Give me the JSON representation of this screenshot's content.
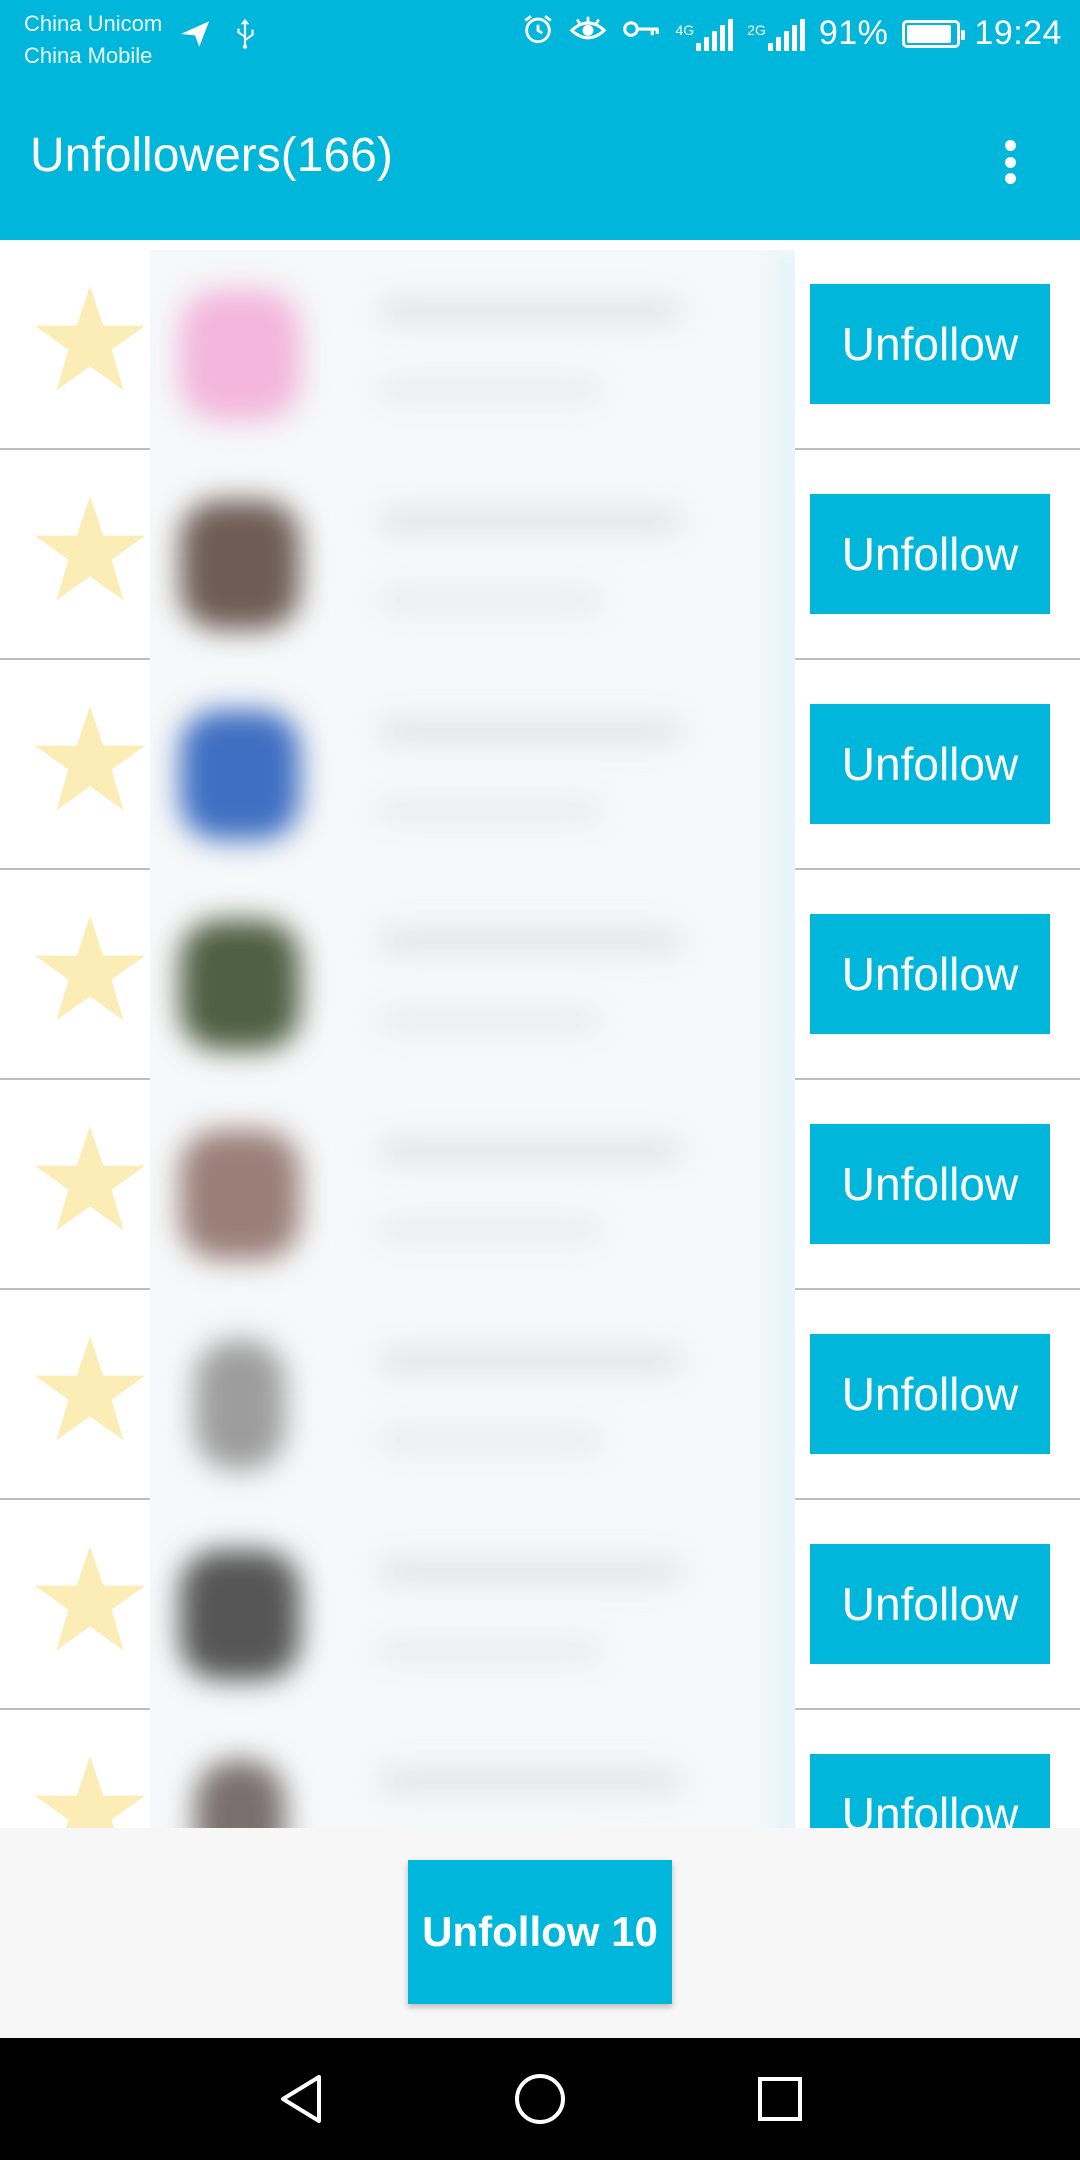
{
  "status_bar": {
    "carrier_1": "China Unicom",
    "carrier_2": "China Mobile",
    "network_1": "4G",
    "network_2": "2G",
    "battery_percent": "91%",
    "battery_level": 0.91,
    "time": "19:24",
    "icons": [
      "send-icon",
      "usb-icon",
      "alarm-icon",
      "eye-icon",
      "key-icon",
      "signal-icon",
      "signal-icon",
      "battery-icon"
    ]
  },
  "app_bar": {
    "title": "Unfollowers(166)",
    "menu_icon": "more-vert-icon"
  },
  "list": {
    "items": [
      {
        "star_icon": "star-icon",
        "button_label": "Unfollow"
      },
      {
        "star_icon": "star-icon",
        "button_label": "Unfollow"
      },
      {
        "star_icon": "star-icon",
        "button_label": "Unfollow"
      },
      {
        "star_icon": "star-icon",
        "button_label": "Unfollow"
      },
      {
        "star_icon": "star-icon",
        "button_label": "Unfollow"
      },
      {
        "star_icon": "star-icon",
        "button_label": "Unfollow"
      },
      {
        "star_icon": "star-icon",
        "button_label": "Unfollow"
      },
      {
        "star_icon": "star-icon",
        "button_label": "Unfollow"
      }
    ]
  },
  "bottom": {
    "bulk_button_label": "Unfollow 10"
  },
  "nav_bar": {
    "back_icon": "back-triangle-icon",
    "home_icon": "home-circle-icon",
    "recents_icon": "recents-square-icon"
  },
  "colors": {
    "accent": "#00B7DB",
    "star": "#FCEDB6",
    "divider": "#BDBDBD",
    "nav": "#000000"
  }
}
